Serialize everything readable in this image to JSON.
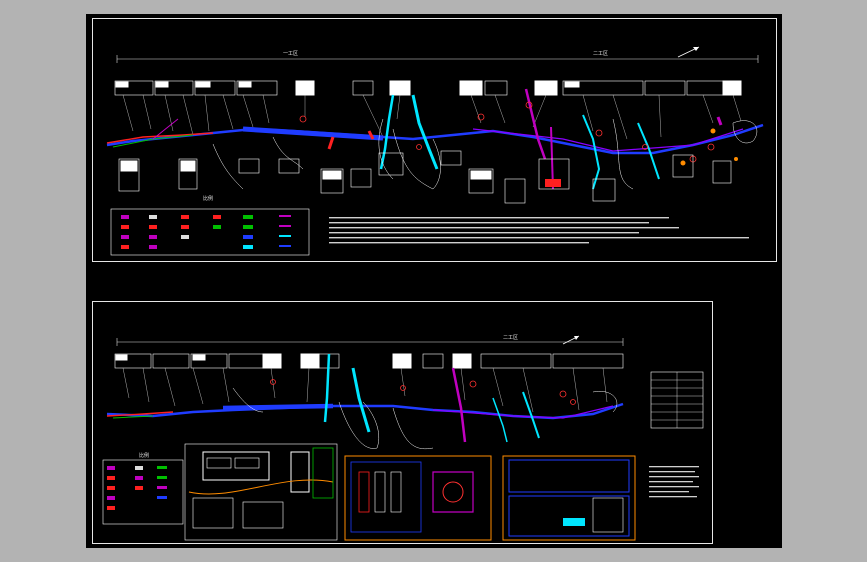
{
  "colors": {
    "app_background": "#b3b3b3",
    "canvas": "#000000",
    "frame": "#e6e6e6",
    "road_blue": "#1f3cff",
    "road_magenta": "#c000c0",
    "road_red": "#ff2020",
    "river_cyan": "#00e6ff",
    "green": "#00c000",
    "orange": "#ff8c00"
  },
  "icons": [
    "north-arrow-icon",
    "legend-symbol-icon",
    "mountain-marker-icon"
  ],
  "sheet_top": {
    "title": "",
    "section_left": "一工区",
    "section_right": "二工区",
    "scale_mark": "比例"
  },
  "sheet_bottom": {
    "title": "",
    "section_left": "",
    "section_right": "二工区",
    "scale_mark": "比例"
  }
}
